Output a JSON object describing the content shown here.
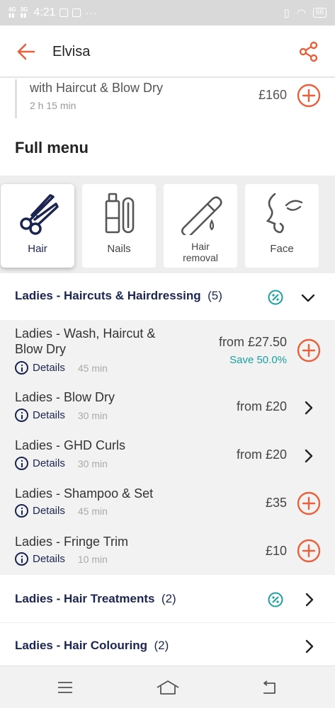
{
  "status_bar": {
    "network_left": "4G",
    "network_right": "3G",
    "time": "4:21",
    "more": "···",
    "battery": "66"
  },
  "app_bar": {
    "title": "Elvisa"
  },
  "previous_item": {
    "name": "with Haircut & Blow Dry",
    "duration": "2 h 15 min",
    "price": "£160"
  },
  "full_menu": {
    "heading": "Full menu"
  },
  "categories": [
    {
      "label": "Hair",
      "icon": "scissors-icon",
      "active": true
    },
    {
      "label": "Nails",
      "icon": "nail-polish-icon",
      "active": false
    },
    {
      "label": "Hair\nremoval",
      "icon": "razor-icon",
      "active": false
    },
    {
      "label": "Face",
      "icon": "face-icon",
      "active": false
    }
  ],
  "sections": [
    {
      "title": "Ladies - Haircuts & Hairdressing",
      "count": "(5)",
      "expanded": true,
      "items": [
        {
          "name": "Ladies - Wash, Haircut & Blow Dry",
          "details": "Details",
          "duration": "45 min",
          "price": "from £27.50",
          "save": "Save 50.0%",
          "action": "add"
        },
        {
          "name": "Ladies - Blow Dry",
          "details": "Details",
          "duration": "30 min",
          "price": "from £20",
          "action": "open"
        },
        {
          "name": "Ladies - GHD Curls",
          "details": "Details",
          "duration": "30 min",
          "price": "from £20",
          "action": "open"
        },
        {
          "name": "Ladies - Shampoo & Set",
          "details": "Details",
          "duration": "45 min",
          "price": "£35",
          "action": "add"
        },
        {
          "name": "Ladies - Fringe Trim",
          "details": "Details",
          "duration": "10 min",
          "price": "£10",
          "action": "add"
        }
      ]
    },
    {
      "title": "Ladies - Hair Treatments",
      "count": "(2)",
      "expanded": false
    },
    {
      "title": "Ladies - Hair Colouring",
      "count": "(2)",
      "expanded": false
    }
  ],
  "colors": {
    "accent": "#e8613c",
    "navy": "#1b2550",
    "teal": "#1aa0a0"
  }
}
